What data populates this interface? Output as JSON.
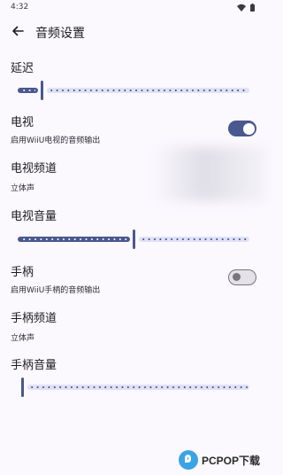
{
  "status_bar": {
    "time": "4:32"
  },
  "app_bar": {
    "title": "音频设置"
  },
  "delay": {
    "label": "延迟",
    "value_fraction": 0.1
  },
  "tv": {
    "label": "电视",
    "description": "启用WiiU电视的音频输出",
    "enabled": true
  },
  "tv_channel": {
    "label": "电视频道",
    "value": "立体声"
  },
  "tv_volume": {
    "label": "电视音量",
    "value_fraction": 0.5
  },
  "gamepad": {
    "label": "手柄",
    "description": "启用WiiU手柄的音频输出",
    "enabled": false
  },
  "gamepad_channel": {
    "label": "手柄频道",
    "value": "立体声"
  },
  "gamepad_volume": {
    "label": "手柄音量",
    "value_fraction": 0.0
  },
  "watermark": {
    "text": "PCPOP下载"
  },
  "colors": {
    "accent": "#4a5890",
    "track_inactive": "#dfe1f5",
    "background": "#fbf8fe"
  }
}
